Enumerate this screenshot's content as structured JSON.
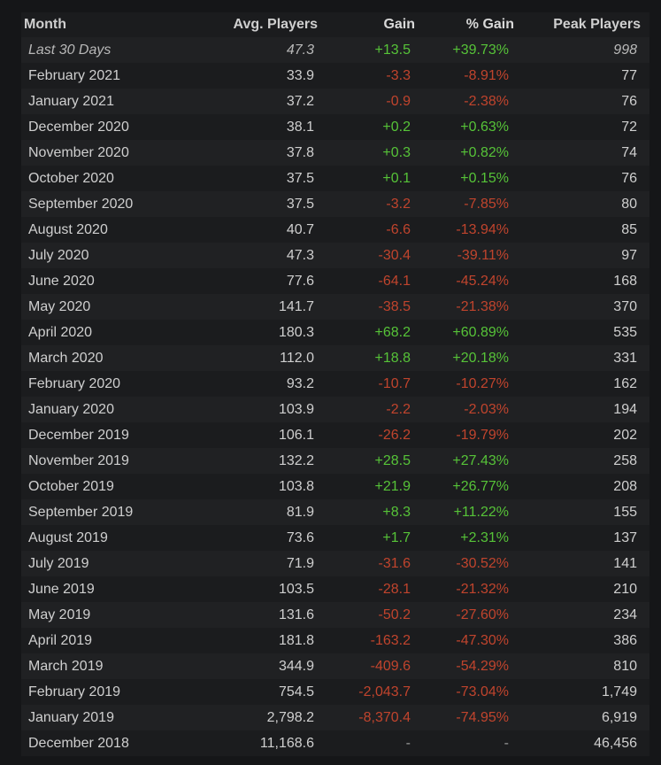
{
  "header": {
    "month": "Month",
    "avg": "Avg. Players",
    "gain": "Gain",
    "pct": "% Gain",
    "peak": "Peak Players"
  },
  "colors": {
    "positive": "#56c338",
    "negative": "#c0442d",
    "background": "#151618",
    "row_alt": "#202123"
  },
  "rows": [
    {
      "month": "Last 30 Days",
      "avg": "47.3",
      "gain": "+13.5",
      "pct": "+39.73%",
      "peak": "998",
      "trend": "pos",
      "italic": true
    },
    {
      "month": "February 2021",
      "avg": "33.9",
      "gain": "-3.3",
      "pct": "-8.91%",
      "peak": "77",
      "trend": "neg"
    },
    {
      "month": "January 2021",
      "avg": "37.2",
      "gain": "-0.9",
      "pct": "-2.38%",
      "peak": "76",
      "trend": "neg"
    },
    {
      "month": "December 2020",
      "avg": "38.1",
      "gain": "+0.2",
      "pct": "+0.63%",
      "peak": "72",
      "trend": "pos"
    },
    {
      "month": "November 2020",
      "avg": "37.8",
      "gain": "+0.3",
      "pct": "+0.82%",
      "peak": "74",
      "trend": "pos"
    },
    {
      "month": "October 2020",
      "avg": "37.5",
      "gain": "+0.1",
      "pct": "+0.15%",
      "peak": "76",
      "trend": "pos"
    },
    {
      "month": "September 2020",
      "avg": "37.5",
      "gain": "-3.2",
      "pct": "-7.85%",
      "peak": "80",
      "trend": "neg"
    },
    {
      "month": "August 2020",
      "avg": "40.7",
      "gain": "-6.6",
      "pct": "-13.94%",
      "peak": "85",
      "trend": "neg"
    },
    {
      "month": "July 2020",
      "avg": "47.3",
      "gain": "-30.4",
      "pct": "-39.11%",
      "peak": "97",
      "trend": "neg"
    },
    {
      "month": "June 2020",
      "avg": "77.6",
      "gain": "-64.1",
      "pct": "-45.24%",
      "peak": "168",
      "trend": "neg"
    },
    {
      "month": "May 2020",
      "avg": "141.7",
      "gain": "-38.5",
      "pct": "-21.38%",
      "peak": "370",
      "trend": "neg"
    },
    {
      "month": "April 2020",
      "avg": "180.3",
      "gain": "+68.2",
      "pct": "+60.89%",
      "peak": "535",
      "trend": "pos"
    },
    {
      "month": "March 2020",
      "avg": "112.0",
      "gain": "+18.8",
      "pct": "+20.18%",
      "peak": "331",
      "trend": "pos"
    },
    {
      "month": "February 2020",
      "avg": "93.2",
      "gain": "-10.7",
      "pct": "-10.27%",
      "peak": "162",
      "trend": "neg"
    },
    {
      "month": "January 2020",
      "avg": "103.9",
      "gain": "-2.2",
      "pct": "-2.03%",
      "peak": "194",
      "trend": "neg"
    },
    {
      "month": "December 2019",
      "avg": "106.1",
      "gain": "-26.2",
      "pct": "-19.79%",
      "peak": "202",
      "trend": "neg"
    },
    {
      "month": "November 2019",
      "avg": "132.2",
      "gain": "+28.5",
      "pct": "+27.43%",
      "peak": "258",
      "trend": "pos"
    },
    {
      "month": "October 2019",
      "avg": "103.8",
      "gain": "+21.9",
      "pct": "+26.77%",
      "peak": "208",
      "trend": "pos"
    },
    {
      "month": "September 2019",
      "avg": "81.9",
      "gain": "+8.3",
      "pct": "+11.22%",
      "peak": "155",
      "trend": "pos"
    },
    {
      "month": "August 2019",
      "avg": "73.6",
      "gain": "+1.7",
      "pct": "+2.31%",
      "peak": "137",
      "trend": "pos"
    },
    {
      "month": "July 2019",
      "avg": "71.9",
      "gain": "-31.6",
      "pct": "-30.52%",
      "peak": "141",
      "trend": "neg"
    },
    {
      "month": "June 2019",
      "avg": "103.5",
      "gain": "-28.1",
      "pct": "-21.32%",
      "peak": "210",
      "trend": "neg"
    },
    {
      "month": "May 2019",
      "avg": "131.6",
      "gain": "-50.2",
      "pct": "-27.60%",
      "peak": "234",
      "trend": "neg"
    },
    {
      "month": "April 2019",
      "avg": "181.8",
      "gain": "-163.2",
      "pct": "-47.30%",
      "peak": "386",
      "trend": "neg"
    },
    {
      "month": "March 2019",
      "avg": "344.9",
      "gain": "-409.6",
      "pct": "-54.29%",
      "peak": "810",
      "trend": "neg"
    },
    {
      "month": "February 2019",
      "avg": "754.5",
      "gain": "-2,043.7",
      "pct": "-73.04%",
      "peak": "1,749",
      "trend": "neg"
    },
    {
      "month": "January 2019",
      "avg": "2,798.2",
      "gain": "-8,370.4",
      "pct": "-74.95%",
      "peak": "6,919",
      "trend": "neg"
    },
    {
      "month": "December 2018",
      "avg": "11,168.6",
      "gain": "-",
      "pct": "-",
      "peak": "46,456",
      "trend": "neu"
    }
  ]
}
